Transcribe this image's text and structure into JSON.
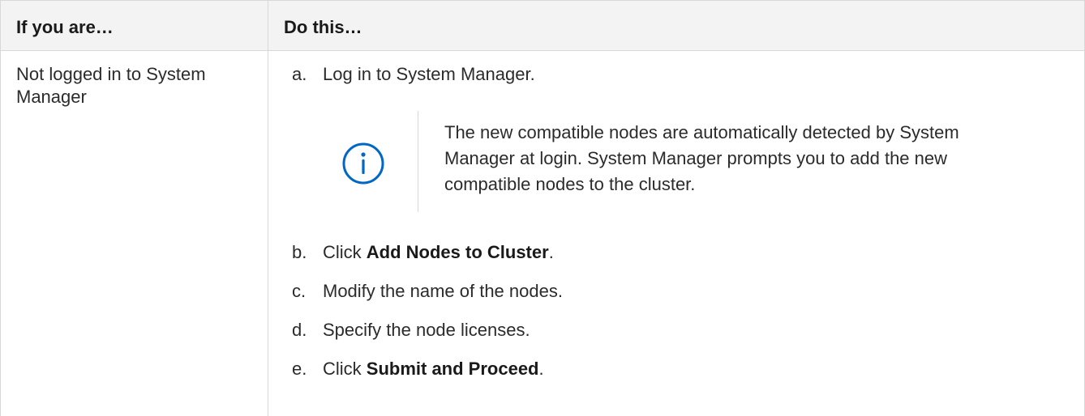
{
  "table": {
    "headers": {
      "col1": "If you are…",
      "col2": "Do this…"
    },
    "row": {
      "condition": "Not logged in to System Manager",
      "steps": {
        "a": {
          "letter": "a.",
          "text": "Log in to System Manager."
        },
        "note": {
          "icon": "info-circle-icon",
          "text": "The new compatible nodes are automatically detected by System Manager at login. System Manager prompts you to add the new compatible nodes to the cluster."
        },
        "b": {
          "letter": "b.",
          "prefix": "Click ",
          "bold": "Add Nodes to Cluster",
          "suffix": "."
        },
        "c": {
          "letter": "c.",
          "text": "Modify the name of the nodes."
        },
        "d": {
          "letter": "d.",
          "text": "Specify the node licenses."
        },
        "e": {
          "letter": "e.",
          "prefix": "Click ",
          "bold": "Submit and Proceed",
          "suffix": "."
        }
      }
    }
  },
  "colors": {
    "icon": "#0067c5",
    "border": "#d8d8d8",
    "header_bg": "#f3f3f3"
  }
}
